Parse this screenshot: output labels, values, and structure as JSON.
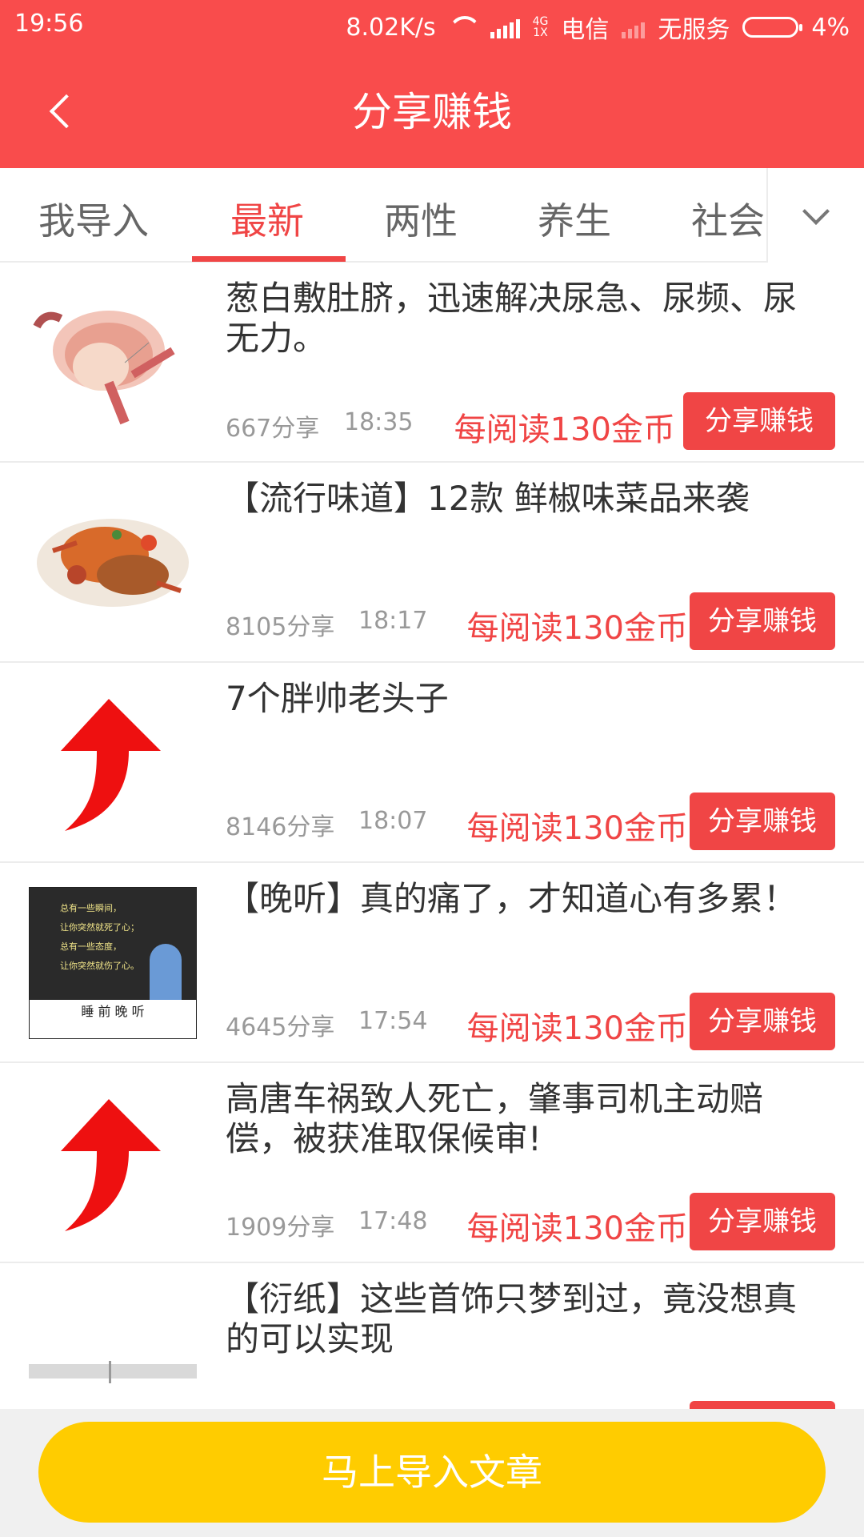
{
  "status_bar": {
    "time": "19:56",
    "speed": "8.02K/s",
    "net_type_top": "4G",
    "net_type_bottom": "1X",
    "carrier": "电信",
    "no_service": "无服务",
    "battery_percent": "4%"
  },
  "header": {
    "title": "分享赚钱"
  },
  "tabs": {
    "items": [
      {
        "label": "我导入"
      },
      {
        "label": "最新"
      },
      {
        "label": "两性"
      },
      {
        "label": "养生"
      },
      {
        "label": "社会"
      }
    ],
    "active_index": 1
  },
  "articles": [
    {
      "title": "葱白敷肚脐，迅速解决尿急、尿频、尿无力。",
      "shares": "667分享",
      "time": "18:35",
      "reward": "每阅读130金币",
      "button": "分享赚钱",
      "thumb": "prostate-illustration"
    },
    {
      "title": "【流行味道】12款 鲜椒味菜品来袭",
      "shares": "8105分享",
      "time": "18:17",
      "reward": "每阅读130金币",
      "button": "分享赚钱",
      "thumb": "crab-dish"
    },
    {
      "title": "7个胖帅老头子",
      "shares": "8146分享",
      "time": "18:07",
      "reward": "每阅读130金币",
      "button": "分享赚钱",
      "thumb": "red-arrow"
    },
    {
      "title": "【晚听】真的痛了，才知道心有多累！",
      "shares": "4645分享",
      "time": "17:54",
      "reward": "每阅读130金币",
      "button": "分享赚钱",
      "thumb": "chalkboard",
      "thumb_caption": "睡 前 晚 听",
      "thumb_lines": [
        "总有一些瞬间，",
        "让你突然就死了心；",
        "总有一些态度，",
        "让你突然就伤了心。"
      ]
    },
    {
      "title": "高唐车祸致人死亡，肇事司机主动赔偿，被获准取保候审!",
      "shares": "1909分享",
      "time": "17:48",
      "reward": "每阅读130金币",
      "button": "分享赚钱",
      "thumb": "red-arrow"
    },
    {
      "title": "【衍纸】这些首饰只梦到过，竟没想真的可以实现",
      "thumb": "paper-quilling"
    }
  ],
  "bottom": {
    "import_button": "马上导入文章"
  },
  "colors": {
    "primary_red": "#f94c4c",
    "accent_red": "#f04545",
    "button_yellow": "#ffcc00"
  }
}
